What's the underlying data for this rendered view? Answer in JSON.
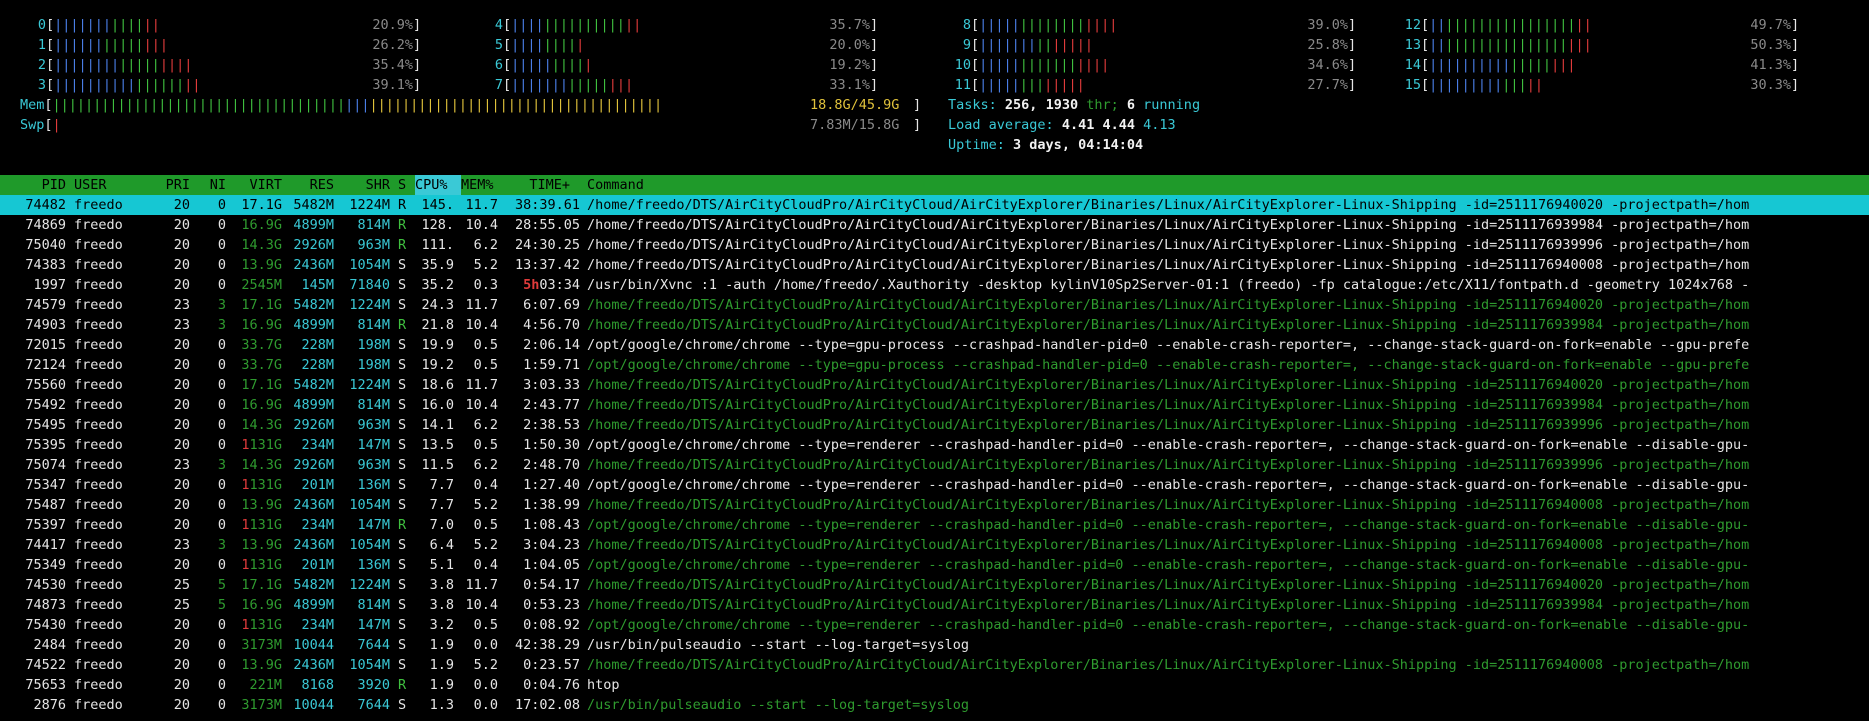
{
  "cpus": [
    {
      "id": "0",
      "pct": "20.9%",
      "blue": 7,
      "green": 4,
      "red": 2
    },
    {
      "id": "1",
      "pct": "26.2%",
      "blue": 6,
      "green": 5,
      "red": 3
    },
    {
      "id": "2",
      "pct": "35.4%",
      "blue": 8,
      "green": 5,
      "red": 4
    },
    {
      "id": "3",
      "pct": "39.1%",
      "blue": 10,
      "green": 6,
      "red": 2
    },
    {
      "id": "4",
      "pct": "35.7%",
      "blue": 4,
      "green": 10,
      "red": 2
    },
    {
      "id": "5",
      "pct": "20.0%",
      "blue": 4,
      "green": 4,
      "red": 1
    },
    {
      "id": "6",
      "pct": "19.2%",
      "blue": 5,
      "green": 4,
      "red": 1
    },
    {
      "id": "7",
      "pct": "33.1%",
      "blue": 7,
      "green": 5,
      "red": 3
    },
    {
      "id": "8",
      "pct": "39.0%",
      "blue": 5,
      "green": 8,
      "red": 4
    },
    {
      "id": "9",
      "pct": "25.8%",
      "blue": 7,
      "green": 2,
      "red": 5
    },
    {
      "id": "10",
      "pct": "34.6%",
      "blue": 5,
      "green": 7,
      "red": 4
    },
    {
      "id": "11",
      "pct": "27.7%",
      "blue": 5,
      "green": 3,
      "red": 5
    },
    {
      "id": "12",
      "pct": "49.7%",
      "blue": 2,
      "green": 16,
      "red": 2
    },
    {
      "id": "13",
      "pct": "50.3%",
      "blue": 2,
      "green": 15,
      "red": 3
    },
    {
      "id": "14",
      "pct": "41.3%",
      "blue": 10,
      "green": 5,
      "red": 3
    },
    {
      "id": "15",
      "pct": "30.3%",
      "blue": 9,
      "green": 3,
      "red": 2
    }
  ],
  "mem": {
    "label": "Mem",
    "value": "18.8G/45.9G",
    "green": 36,
    "blue": 3,
    "yellow": 36
  },
  "swp": {
    "label": "Swp",
    "value": "7.83M/15.8G",
    "red": 1
  },
  "tasks": {
    "label": "Tasks:",
    "count": "256,",
    "thr_count": "1930",
    "thr_label": "thr;",
    "running_count": "6",
    "running_label": "running"
  },
  "load": {
    "label": "Load average:",
    "l1": "4.41",
    "l5": "4.44",
    "l15": "4.13"
  },
  "uptime": {
    "label": "Uptime:",
    "value": "3 days, 04:14:04"
  },
  "columns": {
    "pid": "PID",
    "user": "USER",
    "pri": "PRI",
    "ni": "NI",
    "virt": "VIRT",
    "res": "RES",
    "shr": "SHR",
    "s": "S",
    "cpu": "CPU%",
    "mem": "MEM%",
    "time": "TIME+",
    "cmd": "Command"
  },
  "colors": {
    "header_bg": "#1f9a2a",
    "selected_bg": "#16c7d3",
    "cpu_low": "#4a7ee6",
    "cpu_normal": "#3fbf3f",
    "cpu_kernel": "#e03b3b",
    "mem_cache": "#e0c23b",
    "thread_green": "#2f9b2f"
  },
  "processes": [
    {
      "pid": "74482",
      "user": "freedo",
      "pri": "20",
      "ni": "0",
      "virt": "17.1G",
      "res": "5482M",
      "shr": "1224M",
      "s": "R",
      "cpu": "145.",
      "mem": "11.7",
      "time": "38:39.61",
      "cmd": "/home/freedo/DTS/AirCityCloudPro/AirCityCloud/AirCityExplorer/Binaries/Linux/AirCityExplorer-Linux-Shipping -id=2511176940020 -projectpath=/hom",
      "thread": false,
      "selected": true
    },
    {
      "pid": "74869",
      "user": "freedo",
      "pri": "20",
      "ni": "0",
      "virt": "16.9G",
      "res": "4899M",
      "shr": "814M",
      "s": "R",
      "cpu": "128.",
      "mem": "10.4",
      "time": "28:55.05",
      "cmd": "/home/freedo/DTS/AirCityCloudPro/AirCityCloud/AirCityExplorer/Binaries/Linux/AirCityExplorer-Linux-Shipping -id=2511176939984 -projectpath=/hom",
      "thread": false
    },
    {
      "pid": "75040",
      "user": "freedo",
      "pri": "20",
      "ni": "0",
      "virt": "14.3G",
      "res": "2926M",
      "shr": "963M",
      "s": "R",
      "cpu": "111.",
      "mem": "6.2",
      "time": "24:30.25",
      "cmd": "/home/freedo/DTS/AirCityCloudPro/AirCityCloud/AirCityExplorer/Binaries/Linux/AirCityExplorer-Linux-Shipping -id=2511176939996 -projectpath=/hom",
      "thread": false
    },
    {
      "pid": "74383",
      "user": "freedo",
      "pri": "20",
      "ni": "0",
      "virt": "13.9G",
      "res": "2436M",
      "shr": "1054M",
      "s": "S",
      "cpu": "35.9",
      "mem": "5.2",
      "time": "13:37.42",
      "cmd": "/home/freedo/DTS/AirCityCloudPro/AirCityCloud/AirCityExplorer/Binaries/Linux/AirCityExplorer-Linux-Shipping -id=2511176940008 -projectpath=/hom",
      "thread": false
    },
    {
      "pid": "1997",
      "user": "freedo",
      "pri": "20",
      "ni": "0",
      "virt": "2545M",
      "res": "145M",
      "shr": "71840",
      "s": "S",
      "cpu": "35.2",
      "mem": "0.3",
      "time_hi": "5h",
      "time": "03:34",
      "cmd": "/usr/bin/Xvnc :1 -auth /home/freedo/.Xauthority -desktop kylinV10Sp2Server-01:1 (freedo) -fp catalogue:/etc/X11/fontpath.d -geometry 1024x768 -",
      "thread": false
    },
    {
      "pid": "74579",
      "user": "freedo",
      "pri": "23",
      "ni": "3",
      "virt": "17.1G",
      "res": "5482M",
      "shr": "1224M",
      "s": "S",
      "cpu": "24.3",
      "mem": "11.7",
      "time": "6:07.69",
      "cmd": "/home/freedo/DTS/AirCityCloudPro/AirCityCloud/AirCityExplorer/Binaries/Linux/AirCityExplorer-Linux-Shipping -id=2511176940020 -projectpath=/hom",
      "thread": true
    },
    {
      "pid": "74903",
      "user": "freedo",
      "pri": "23",
      "ni": "3",
      "virt": "16.9G",
      "res": "4899M",
      "shr": "814M",
      "s": "R",
      "cpu": "21.8",
      "mem": "10.4",
      "time": "4:56.70",
      "cmd": "/home/freedo/DTS/AirCityCloudPro/AirCityCloud/AirCityExplorer/Binaries/Linux/AirCityExplorer-Linux-Shipping -id=2511176939984 -projectpath=/hom",
      "thread": true
    },
    {
      "pid": "72015",
      "user": "freedo",
      "pri": "20",
      "ni": "0",
      "virt": "33.7G",
      "res": "228M",
      "shr": "198M",
      "s": "S",
      "cpu": "19.9",
      "mem": "0.5",
      "time": "2:06.14",
      "cmd": "/opt/google/chrome/chrome --type=gpu-process --crashpad-handler-pid=0 --enable-crash-reporter=, --change-stack-guard-on-fork=enable --gpu-prefe",
      "thread": false
    },
    {
      "pid": "72124",
      "user": "freedo",
      "pri": "20",
      "ni": "0",
      "virt": "33.7G",
      "res": "228M",
      "shr": "198M",
      "s": "S",
      "cpu": "19.2",
      "mem": "0.5",
      "time": "1:59.71",
      "cmd": "/opt/google/chrome/chrome --type=gpu-process --crashpad-handler-pid=0 --enable-crash-reporter=, --change-stack-guard-on-fork=enable --gpu-prefe",
      "thread": true
    },
    {
      "pid": "75560",
      "user": "freedo",
      "pri": "20",
      "ni": "0",
      "virt": "17.1G",
      "res": "5482M",
      "shr": "1224M",
      "s": "S",
      "cpu": "18.6",
      "mem": "11.7",
      "time": "3:03.33",
      "cmd": "/home/freedo/DTS/AirCityCloudPro/AirCityCloud/AirCityExplorer/Binaries/Linux/AirCityExplorer-Linux-Shipping -id=2511176940020 -projectpath=/hom",
      "thread": true
    },
    {
      "pid": "75492",
      "user": "freedo",
      "pri": "20",
      "ni": "0",
      "virt": "16.9G",
      "res": "4899M",
      "shr": "814M",
      "s": "S",
      "cpu": "16.0",
      "mem": "10.4",
      "time": "2:43.77",
      "cmd": "/home/freedo/DTS/AirCityCloudPro/AirCityCloud/AirCityExplorer/Binaries/Linux/AirCityExplorer-Linux-Shipping -id=2511176939984 -projectpath=/hom",
      "thread": true
    },
    {
      "pid": "75495",
      "user": "freedo",
      "pri": "20",
      "ni": "0",
      "virt": "14.3G",
      "res": "2926M",
      "shr": "963M",
      "s": "S",
      "cpu": "14.1",
      "mem": "6.2",
      "time": "2:38.53",
      "cmd": "/home/freedo/DTS/AirCityCloudPro/AirCityCloud/AirCityExplorer/Binaries/Linux/AirCityExplorer-Linux-Shipping -id=2511176939996 -projectpath=/hom",
      "thread": true
    },
    {
      "pid": "75395",
      "user": "freedo",
      "pri": "20",
      "ni": "0",
      "virt_hi": "1",
      "virt": "131G",
      "res": "234M",
      "shr": "147M",
      "s": "S",
      "cpu": "13.5",
      "mem": "0.5",
      "time": "1:50.30",
      "cmd": "/opt/google/chrome/chrome --type=renderer --crashpad-handler-pid=0 --enable-crash-reporter=, --change-stack-guard-on-fork=enable --disable-gpu-",
      "thread": false
    },
    {
      "pid": "75074",
      "user": "freedo",
      "pri": "23",
      "ni": "3",
      "virt": "14.3G",
      "res": "2926M",
      "shr": "963M",
      "s": "S",
      "cpu": "11.5",
      "mem": "6.2",
      "time": "2:48.70",
      "cmd": "/home/freedo/DTS/AirCityCloudPro/AirCityCloud/AirCityExplorer/Binaries/Linux/AirCityExplorer-Linux-Shipping -id=2511176939996 -projectpath=/hom",
      "thread": true
    },
    {
      "pid": "75347",
      "user": "freedo",
      "pri": "20",
      "ni": "0",
      "virt_hi": "1",
      "virt": "131G",
      "res": "201M",
      "shr": "136M",
      "s": "S",
      "cpu": "7.7",
      "mem": "0.4",
      "time": "1:27.40",
      "cmd": "/opt/google/chrome/chrome --type=renderer --crashpad-handler-pid=0 --enable-crash-reporter=, --change-stack-guard-on-fork=enable --disable-gpu-",
      "thread": false
    },
    {
      "pid": "75487",
      "user": "freedo",
      "pri": "20",
      "ni": "0",
      "virt": "13.9G",
      "res": "2436M",
      "shr": "1054M",
      "s": "S",
      "cpu": "7.7",
      "mem": "5.2",
      "time": "1:38.99",
      "cmd": "/home/freedo/DTS/AirCityCloudPro/AirCityCloud/AirCityExplorer/Binaries/Linux/AirCityExplorer-Linux-Shipping -id=2511176940008 -projectpath=/hom",
      "thread": true
    },
    {
      "pid": "75397",
      "user": "freedo",
      "pri": "20",
      "ni": "0",
      "virt_hi": "1",
      "virt": "131G",
      "res": "234M",
      "shr": "147M",
      "s": "R",
      "cpu": "7.0",
      "mem": "0.5",
      "time": "1:08.43",
      "cmd": "/opt/google/chrome/chrome --type=renderer --crashpad-handler-pid=0 --enable-crash-reporter=, --change-stack-guard-on-fork=enable --disable-gpu-",
      "thread": true
    },
    {
      "pid": "74417",
      "user": "freedo",
      "pri": "23",
      "ni": "3",
      "virt": "13.9G",
      "res": "2436M",
      "shr": "1054M",
      "s": "S",
      "cpu": "6.4",
      "mem": "5.2",
      "time": "3:04.23",
      "cmd": "/home/freedo/DTS/AirCityCloudPro/AirCityCloud/AirCityExplorer/Binaries/Linux/AirCityExplorer-Linux-Shipping -id=2511176940008 -projectpath=/hom",
      "thread": true
    },
    {
      "pid": "75349",
      "user": "freedo",
      "pri": "20",
      "ni": "0",
      "virt_hi": "1",
      "virt": "131G",
      "res": "201M",
      "shr": "136M",
      "s": "S",
      "cpu": "5.1",
      "mem": "0.4",
      "time": "1:04.05",
      "cmd": "/opt/google/chrome/chrome --type=renderer --crashpad-handler-pid=0 --enable-crash-reporter=, --change-stack-guard-on-fork=enable --disable-gpu-",
      "thread": true
    },
    {
      "pid": "74530",
      "user": "freedo",
      "pri": "25",
      "ni": "5",
      "virt": "17.1G",
      "res": "5482M",
      "shr": "1224M",
      "s": "S",
      "cpu": "3.8",
      "mem": "11.7",
      "time": "0:54.17",
      "cmd": "/home/freedo/DTS/AirCityCloudPro/AirCityCloud/AirCityExplorer/Binaries/Linux/AirCityExplorer-Linux-Shipping -id=2511176940020 -projectpath=/hom",
      "thread": true
    },
    {
      "pid": "74873",
      "user": "freedo",
      "pri": "25",
      "ni": "5",
      "virt": "16.9G",
      "res": "4899M",
      "shr": "814M",
      "s": "S",
      "cpu": "3.8",
      "mem": "10.4",
      "time": "0:53.23",
      "cmd": "/home/freedo/DTS/AirCityCloudPro/AirCityCloud/AirCityExplorer/Binaries/Linux/AirCityExplorer-Linux-Shipping -id=2511176939984 -projectpath=/hom",
      "thread": true
    },
    {
      "pid": "75430",
      "user": "freedo",
      "pri": "20",
      "ni": "0",
      "virt_hi": "1",
      "virt": "131G",
      "res": "234M",
      "shr": "147M",
      "s": "S",
      "cpu": "3.2",
      "mem": "0.5",
      "time": "0:08.92",
      "cmd": "/opt/google/chrome/chrome --type=renderer --crashpad-handler-pid=0 --enable-crash-reporter=, --change-stack-guard-on-fork=enable --disable-gpu-",
      "thread": true
    },
    {
      "pid": "2484",
      "user": "freedo",
      "pri": "20",
      "ni": "0",
      "virt": "3173M",
      "res": "10044",
      "shr": "7644",
      "s": "S",
      "cpu": "1.9",
      "mem": "0.0",
      "time": "42:38.29",
      "cmd": "/usr/bin/pulseaudio --start --log-target=syslog",
      "thread": false
    },
    {
      "pid": "74522",
      "user": "freedo",
      "pri": "20",
      "ni": "0",
      "virt": "13.9G",
      "res": "2436M",
      "shr": "1054M",
      "s": "S",
      "cpu": "1.9",
      "mem": "5.2",
      "time": "0:23.57",
      "cmd": "/home/freedo/DTS/AirCityCloudPro/AirCityCloud/AirCityExplorer/Binaries/Linux/AirCityExplorer-Linux-Shipping -id=2511176940008 -projectpath=/hom",
      "thread": true
    },
    {
      "pid": "75653",
      "user": "freedo",
      "pri": "20",
      "ni": "0",
      "virt": "221M",
      "res": "8168",
      "shr": "3920",
      "s": "R",
      "cpu": "1.9",
      "mem": "0.0",
      "time": "0:04.76",
      "cmd": "htop",
      "thread": false
    },
    {
      "pid": "2876",
      "user": "freedo",
      "pri": "20",
      "ni": "0",
      "virt": "3173M",
      "res": "10044",
      "shr": "7644",
      "s": "S",
      "cpu": "1.3",
      "mem": "0.0",
      "time": "17:02.08",
      "cmd": "/usr/bin/pulseaudio --start --log-target=syslog",
      "thread": true
    }
  ]
}
